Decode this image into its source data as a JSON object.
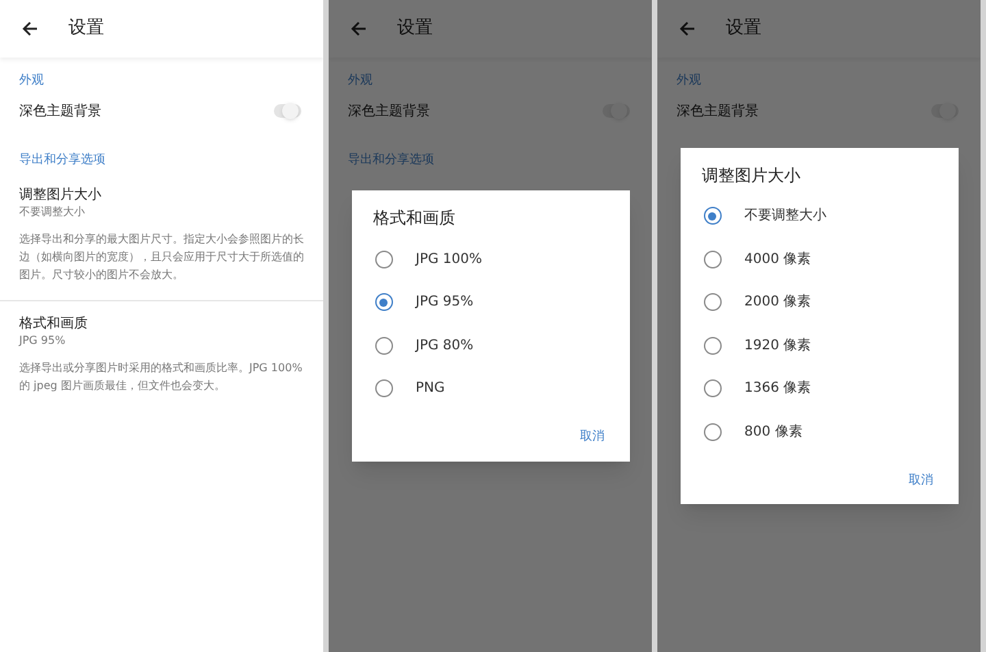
{
  "screens": [
    {
      "title": "设置",
      "dimmed": false,
      "items": [
        {
          "kind": "section",
          "label": "外观"
        },
        {
          "kind": "toggle",
          "label": "深色主题背景",
          "on": false
        },
        {
          "kind": "section",
          "label": "导出和分享选项"
        },
        {
          "kind": "setting",
          "label": "调整图片大小",
          "value": "不要调整大小",
          "description": "选择导出和分享的最大图片尺寸。指定大小会参照图片的长边（如横向图片的宽度），且只会应用于尺寸大于所选值的图片。尺寸较小的图片不会放大。"
        },
        {
          "kind": "setting",
          "label": "格式和画质",
          "value": "JPG 95%",
          "description": "选择导出或分享图片时采用的格式和画质比率。JPG 100% 的 jpeg 图片画质最佳，但文件也会变大。"
        }
      ]
    },
    {
      "title": "设置",
      "dimmed": true,
      "items": [
        {
          "kind": "section",
          "label": "外观"
        },
        {
          "kind": "toggle",
          "label": "深色主题背景",
          "on": false
        },
        {
          "kind": "section",
          "label": "导出和分享选项"
        }
      ],
      "dialog": {
        "title": "格式和画质",
        "button": "取消",
        "options": [
          {
            "label": "JPG 100%",
            "selected": false
          },
          {
            "label": "JPG 95%",
            "selected": true
          },
          {
            "label": "JPG 80%",
            "selected": false
          },
          {
            "label": "PNG",
            "selected": false
          }
        ]
      }
    },
    {
      "title": "设置",
      "dimmed": true,
      "items": [
        {
          "kind": "section",
          "label": "外观"
        },
        {
          "kind": "toggle",
          "label": "深色主题背景",
          "on": false
        }
      ],
      "dialog": {
        "title": "调整图片大小",
        "button": "取消",
        "options": [
          {
            "label": "不要调整大小",
            "selected": true
          },
          {
            "label": "4000 像素",
            "selected": false
          },
          {
            "label": "2000 像素",
            "selected": false
          },
          {
            "label": "1920 像素",
            "selected": false
          },
          {
            "label": "1366 像素",
            "selected": false
          },
          {
            "label": "800 像素",
            "selected": false
          }
        ]
      }
    }
  ]
}
